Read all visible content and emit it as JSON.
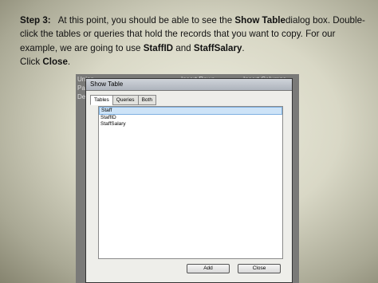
{
  "instructions": {
    "step_label": "Step 3:",
    "part1": "At this point, you should be able to see the ",
    "bold_show_table": "Show Table",
    "part2": "dialog box. Double-click the tables or queries that hold the records that you want to copy. For our example, we are going to use ",
    "bold_staffid": "StaffID",
    "part3": " and ",
    "bold_staffsalary": "StaffSalary",
    "part4": ".",
    "part5": "Click ",
    "bold_close": "Close",
    "part6": "."
  },
  "background_fragments": [
    "Union",
    "Pa",
    "De",
    "Insert Rows",
    "Insert Columns"
  ],
  "dialog": {
    "title": "Show Table",
    "tabs": [
      "Tables",
      "Queries",
      "Both"
    ],
    "active_tab": "Tables",
    "items": [
      "Staff",
      "StaffID",
      "StaffSalary"
    ],
    "selected_item": "Staff",
    "add_label": "Add",
    "close_label": "Close"
  }
}
